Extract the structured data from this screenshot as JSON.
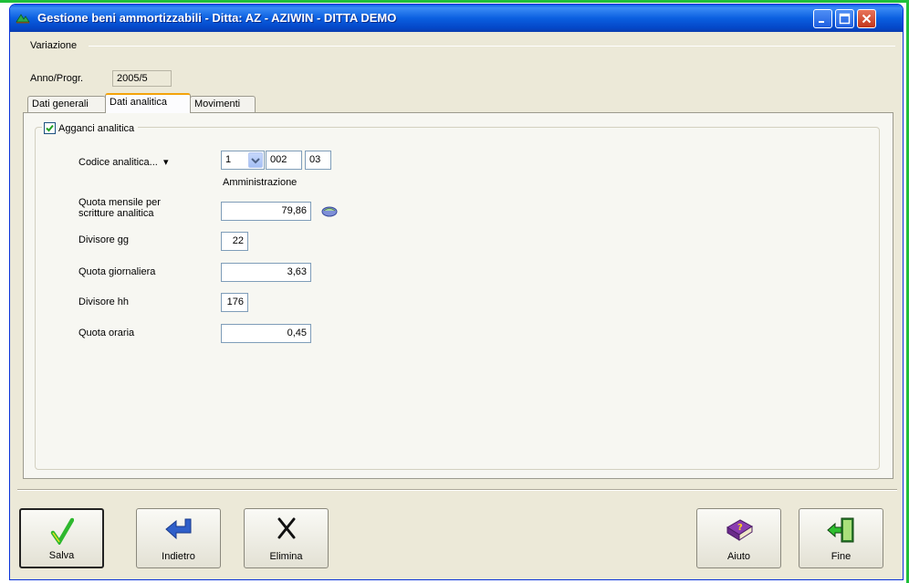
{
  "window": {
    "title": "Gestione beni ammortizzabili - Ditta: AZ - AZIWIN - DITTA DEMO"
  },
  "header": {
    "mode_label": "Variazione",
    "anno_label": "Anno/Progr.",
    "anno_value": "2005/5"
  },
  "tabs": [
    {
      "label": "Dati generali"
    },
    {
      "label": "Dati analitica"
    },
    {
      "label": "Movimenti"
    }
  ],
  "analitica": {
    "group_label": "Agganci analitica",
    "group_checked": true,
    "codice_label": "Codice analitica...",
    "codice_combo_value": "1",
    "codice_field2": "002",
    "codice_field3": "03",
    "codice_description": "Amministrazione",
    "quota_mensile_label_line1": "Quota mensile per",
    "quota_mensile_label_line2": "scritture analitica",
    "quota_mensile_value": "79,86",
    "divisore_gg_label": "Divisore gg",
    "divisore_gg_value": "22",
    "quota_giornaliera_label": "Quota giornaliera",
    "quota_giornaliera_value": "3,63",
    "divisore_hh_label": "Divisore hh",
    "divisore_hh_value": "176",
    "quota_oraria_label": "Quota oraria",
    "quota_oraria_value": "0,45"
  },
  "buttons": {
    "salva": "Salva",
    "indietro": "Indietro",
    "elimina": "Elimina",
    "aiuto": "Aiuto",
    "fine": "Fine"
  }
}
